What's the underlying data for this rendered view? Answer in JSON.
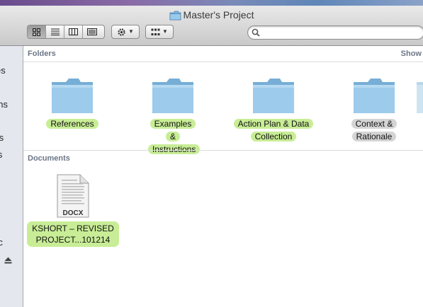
{
  "window": {
    "title": "Master's Project"
  },
  "toolbar": {
    "view_buttons": [
      "icon-view",
      "list-view",
      "column-view",
      "cover-flow-view"
    ],
    "action_icon": "gear-icon",
    "arrange_icon": "arrange-grid-icon",
    "search": {
      "value": "",
      "placeholder": ""
    }
  },
  "sidebar": {
    "items": [
      {
        "label": "es"
      },
      {
        "label": "ons"
      },
      {
        "label": "ts"
      },
      {
        "label": "ls"
      },
      {
        "label": "isc"
      }
    ]
  },
  "folders_section": {
    "header": "Folders",
    "show_link": "Show",
    "items": [
      {
        "label": "References",
        "tag": "green"
      },
      {
        "label": "Examples & Instructions",
        "tag": "green"
      },
      {
        "label": "Action Plan & Data Collection",
        "tag": "green"
      },
      {
        "label": "Context & Rationale",
        "tag": "gray"
      }
    ]
  },
  "documents_section": {
    "header": "Documents",
    "items": [
      {
        "label": "KSHORT – REVISED PROJECT...101214",
        "icon_caption": "DOCX",
        "tag": "green"
      }
    ]
  },
  "colors": {
    "green_tag": "#c8ed96",
    "gray_tag": "#d4d4d4",
    "folder_blue": "#8fbfe0",
    "section_header": "#6b7686",
    "sidebar_bg": "#e4e8ee"
  }
}
